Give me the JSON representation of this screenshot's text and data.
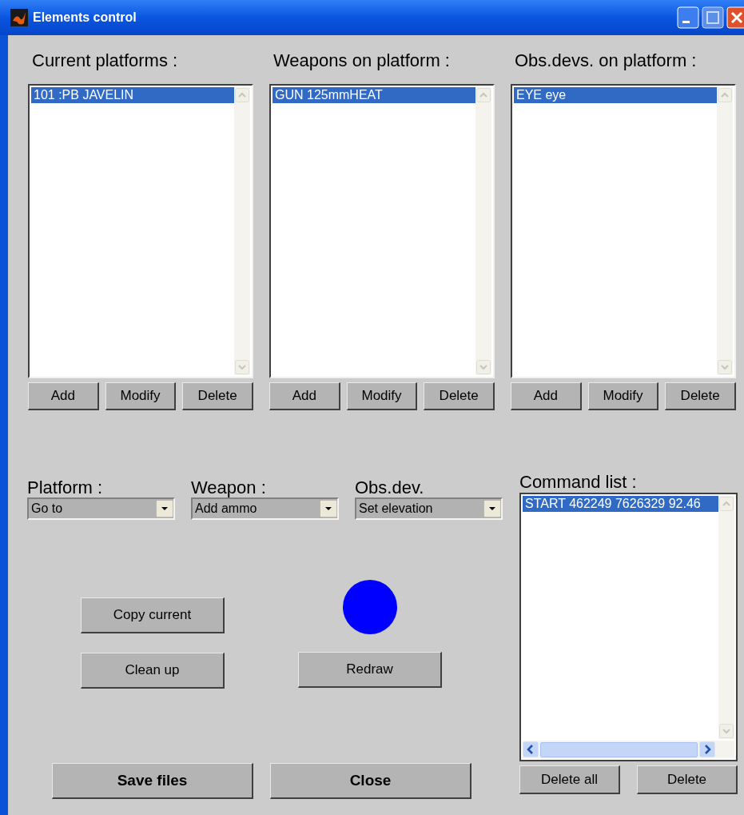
{
  "window": {
    "title": "Elements control"
  },
  "panels": [
    {
      "label": "Current platforms :",
      "items": [
        {
          "text": "101 :PB JAVELIN",
          "selected": true
        }
      ],
      "buttons": [
        "Add",
        "Modify",
        "Delete"
      ]
    },
    {
      "label": "Weapons on platform :",
      "items": [
        {
          "text": "GUN 125mmHEAT",
          "selected": true
        }
      ],
      "buttons": [
        "Add",
        "Modify",
        "Delete"
      ]
    },
    {
      "label": "Obs.devs. on platform :",
      "items": [
        {
          "text": "EYE eye",
          "selected": true
        }
      ],
      "buttons": [
        "Add",
        "Modify",
        "Delete"
      ]
    }
  ],
  "dropdowns": [
    {
      "label": "Platform :",
      "value": "Go to"
    },
    {
      "label": "Weapon :",
      "value": "Add ammo"
    },
    {
      "label": "Obs.dev.",
      "value": "Set elevation"
    }
  ],
  "actions": {
    "copy": "Copy current",
    "cleanup": "Clean up",
    "redraw": "Redraw"
  },
  "footer_buttons": [
    "Save files",
    "Close"
  ],
  "command_list": {
    "label": "Command list :",
    "items": [
      {
        "text": "START 462249 7626329 92.46",
        "selected": true
      }
    ],
    "buttons": [
      "Delete all",
      "Delete"
    ]
  }
}
